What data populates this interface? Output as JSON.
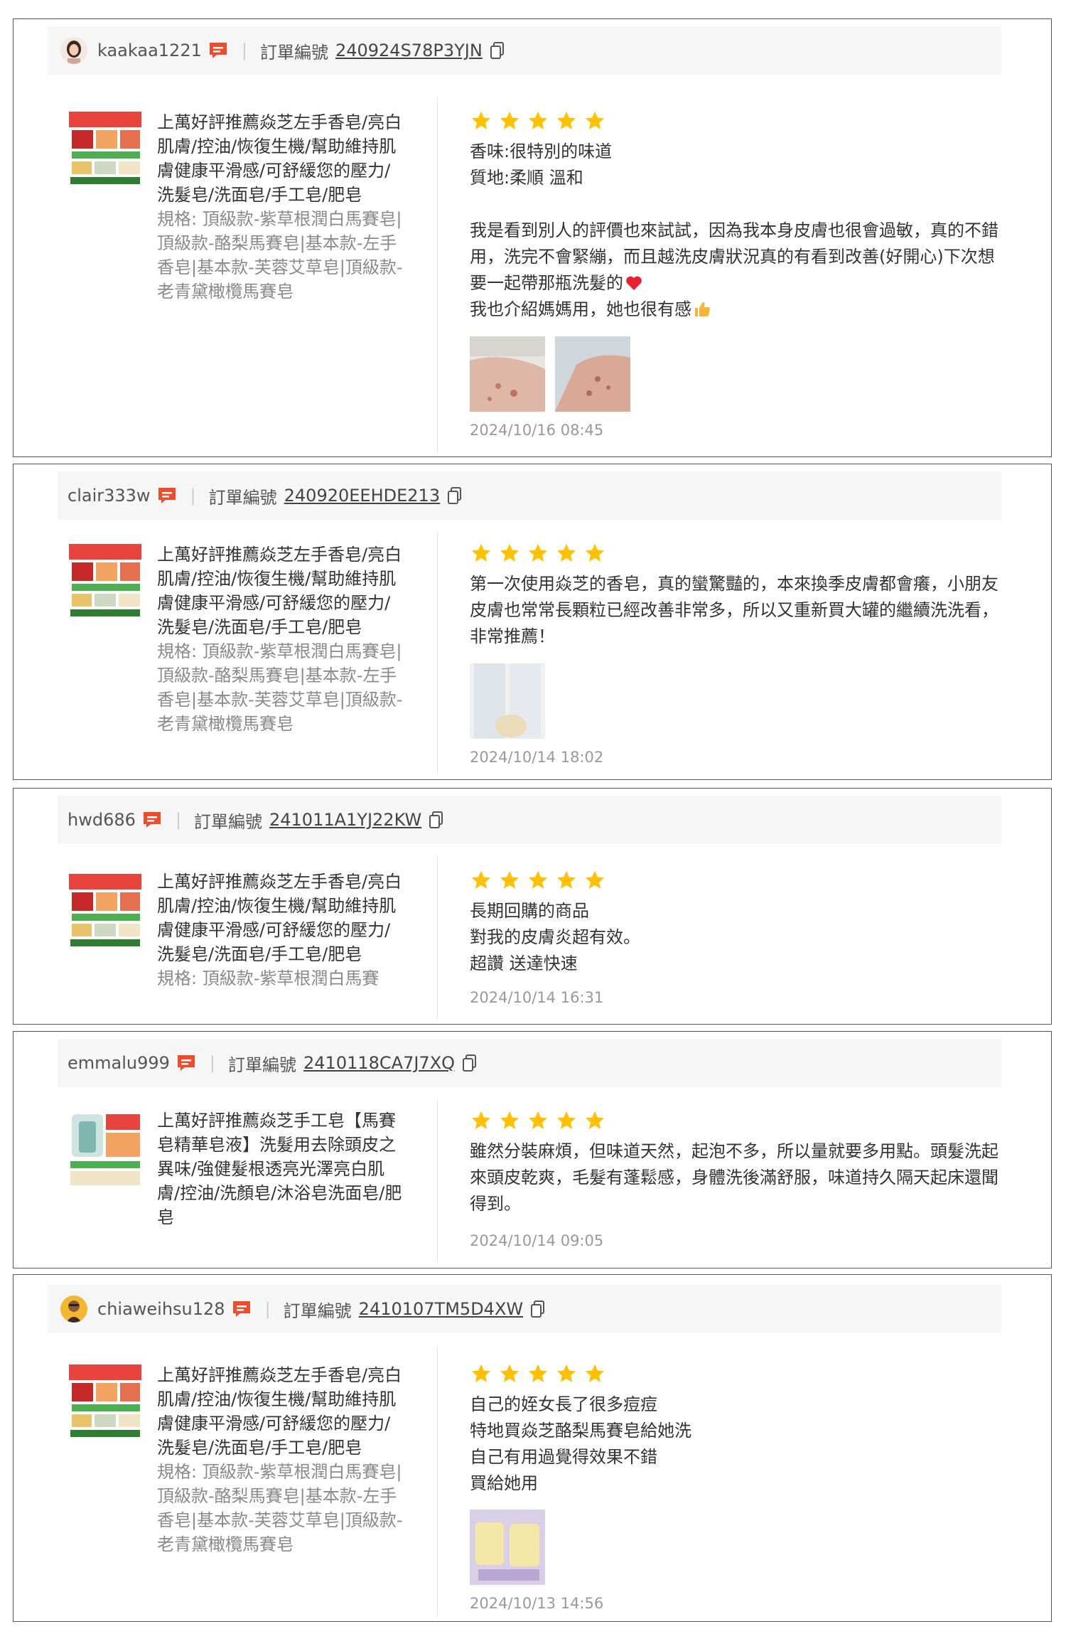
{
  "order_label": "訂單編號",
  "product_title_main": "上萬好評推薦焱芝左手香皂/亮白肌膚/控油/恢復生機/幫助維持肌膚健康平滑感/可舒緩您的壓力/洗髮皂/洗面皂/手工皂/肥皂",
  "product_title_alt": "上萬好評推薦焱芝手工皂【馬賽皂精華皂液】洗髮用去除頭皮之異味/強健髮根透亮光澤亮白肌膚/控油/洗顏皂/沐浴皂洗面皂/肥皂",
  "spec_full": "規格: 頂級款-紫草根潤白馬賽皂|頂級款-酪梨馬賽皂|基本款-左手香皂|基本款-芙蓉艾草皂|頂級款-老青黛橄欖馬賽皂",
  "spec_short": "規格: 頂級款-紫草根潤白馬賽",
  "reviews": [
    {
      "username": "kaakaa1221",
      "order_id": "240924S78P3YJN",
      "rating": 5,
      "text": "香味:很特別的味道\n質地:柔順 溫和\n\n我是看到別人的評價也來試試，因為我本身皮膚也很會過敏，真的不錯用，洗完不會緊繃，而且越洗皮膚狀況真的有看到改善(好開心)下次想要一起帶那瓶洗髮的",
      "text_tail": "我也介紹媽媽用，她也很有感",
      "date": "2024/10/16 08:45"
    },
    {
      "username": "clair333w",
      "order_id": "240920EEHDE213",
      "rating": 5,
      "text": "第一次使用焱芝的香皂，真的蠻驚豔的，本來換季皮膚都會癢，小朋友皮膚也常常長顆粒已經改善非常多，所以又重新買大罐的繼續洗洗看，非常推薦！",
      "date": "2024/10/14 18:02"
    },
    {
      "username": "hwd686",
      "order_id": "241011A1YJ22KW",
      "rating": 5,
      "text": "長期回購的商品\n對我的皮膚炎超有效。\n超讚  送達快速",
      "date": "2024/10/14 16:31"
    },
    {
      "username": "emmalu999",
      "order_id": "2410118CA7J7XQ",
      "rating": 5,
      "text": "雖然分裝麻煩，但味道天然，起泡不多，所以量就要多用點。頭髮洗起來頭皮乾爽，毛髮有蓬鬆感，身體洗後滿舒服，味道持久隔天起床還聞得到。",
      "date": "2024/10/14 09:05"
    },
    {
      "username": "chiaweihsu128",
      "order_id": "2410107TM5D4XW",
      "rating": 5,
      "text": "自己的姪女長了很多痘痘\n特地買焱芝酪梨馬賽皂給她洗\n自己有用過覺得效果不錯\n買給她用",
      "date": "2024/10/13 14:56"
    }
  ],
  "colors": {
    "star": "#ffc107",
    "chat_icon": "#ee4d2d",
    "border": "#555555",
    "header_bg": "#f6f6f6"
  }
}
